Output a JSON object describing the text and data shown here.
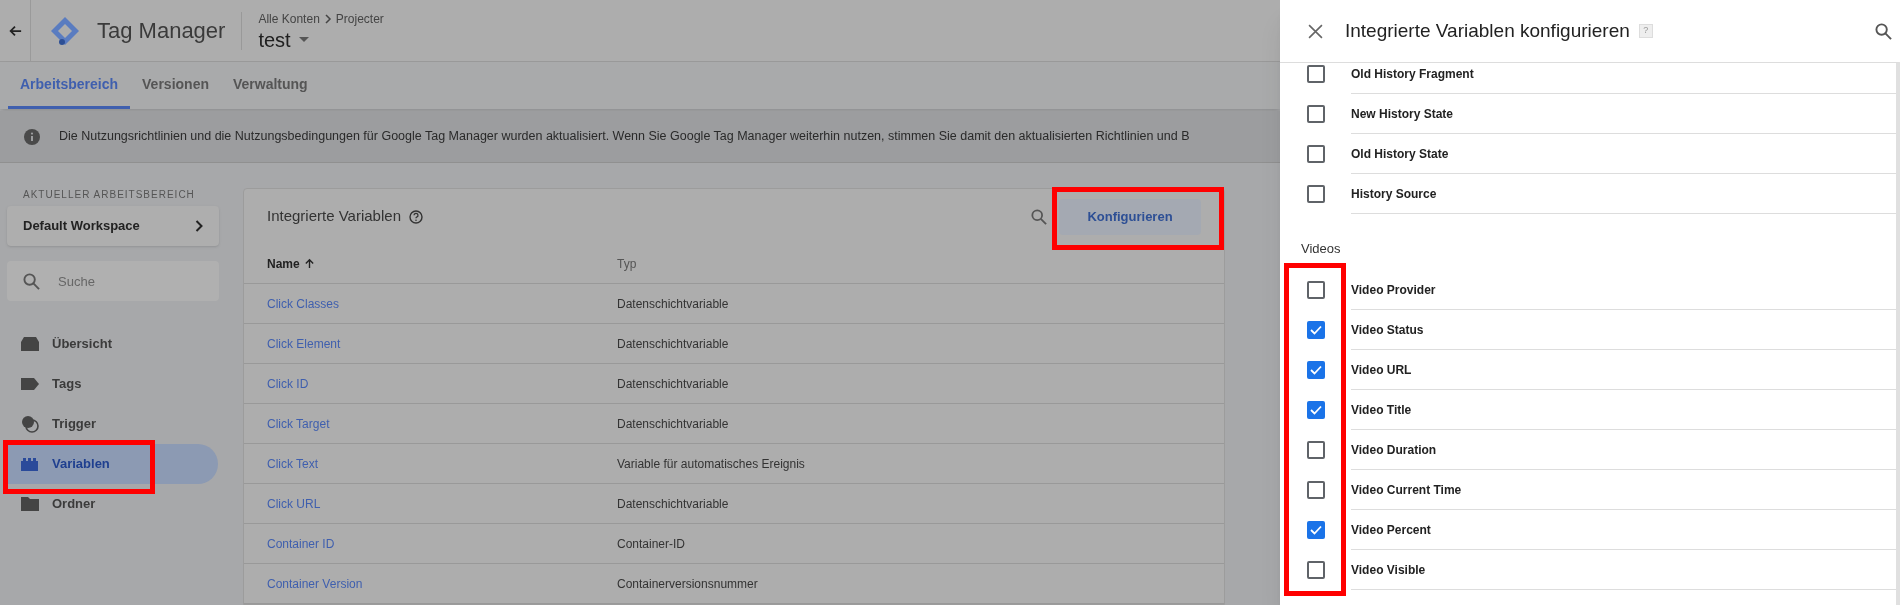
{
  "header": {
    "product": "Tag Manager",
    "breadcrumb": [
      "Alle Konten",
      "Projecter"
    ],
    "container": "test"
  },
  "tabs": [
    {
      "label": "Arbeitsbereich",
      "selected": true
    },
    {
      "label": "Versionen",
      "selected": false
    },
    {
      "label": "Verwaltung",
      "selected": false
    }
  ],
  "banner": {
    "text": "Die Nutzungsrichtlinien und die Nutzungsbedingungen für Google Tag Manager wurden aktualisiert. Wenn Sie Google Tag Manager weiterhin nutzen, stimmen Sie damit den aktualisierten Richtlinien und B"
  },
  "sidebar": {
    "section_label": "AKTUELLER ARBEITSBEREICH",
    "workspace": "Default Workspace",
    "search": {
      "placeholder": "Suche"
    },
    "items": [
      {
        "kind": "overview",
        "label": "Übersicht",
        "selected": false
      },
      {
        "kind": "tag",
        "label": "Tags",
        "selected": false
      },
      {
        "kind": "trigger",
        "label": "Trigger",
        "selected": false
      },
      {
        "kind": "variable",
        "label": "Variablen",
        "selected": true
      },
      {
        "kind": "folder",
        "label": "Ordner",
        "selected": false
      }
    ]
  },
  "card": {
    "title": "Integrierte Variablen",
    "configure_button": "Konfigurieren",
    "columns": [
      "Name",
      "Typ"
    ],
    "rows": [
      {
        "name": "Click Classes",
        "type": "Datenschichtvariable"
      },
      {
        "name": "Click Element",
        "type": "Datenschichtvariable"
      },
      {
        "name": "Click ID",
        "type": "Datenschichtvariable"
      },
      {
        "name": "Click Target",
        "type": "Datenschichtvariable"
      },
      {
        "name": "Click Text",
        "type": "Variable für automatisches Ereignis"
      },
      {
        "name": "Click URL",
        "type": "Datenschichtvariable"
      },
      {
        "name": "Container ID",
        "type": "Container-ID"
      },
      {
        "name": "Container Version",
        "type": "Containerversionsnummer"
      }
    ]
  },
  "panel": {
    "title": "Integrierte Variablen konfigurieren",
    "help_mark": "?",
    "groups": [
      {
        "items": [
          {
            "label": "Old History Fragment",
            "checked": false
          },
          {
            "label": "New History State",
            "checked": false
          },
          {
            "label": "Old History State",
            "checked": false
          },
          {
            "label": "History Source",
            "checked": false
          }
        ]
      },
      {
        "title": "Videos",
        "items": [
          {
            "label": "Video Provider",
            "checked": false
          },
          {
            "label": "Video Status",
            "checked": true
          },
          {
            "label": "Video URL",
            "checked": true
          },
          {
            "label": "Video Title",
            "checked": true
          },
          {
            "label": "Video Duration",
            "checked": false
          },
          {
            "label": "Video Current Time",
            "checked": false
          },
          {
            "label": "Video Percent",
            "checked": true
          },
          {
            "label": "Video Visible",
            "checked": false
          }
        ]
      }
    ]
  }
}
